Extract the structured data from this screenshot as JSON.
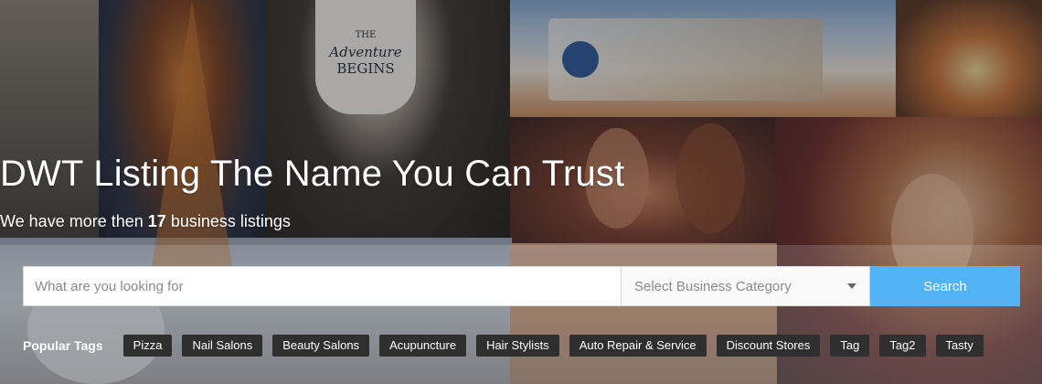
{
  "hero": {
    "title": "DWT Listing The Name You Can Trust",
    "subtitle_prefix": "We have more then",
    "listing_count": "17",
    "subtitle_suffix": "business listings",
    "mug_text_1": "THE",
    "mug_text_2": "Adventure",
    "mug_text_3": "BEGINS"
  },
  "search": {
    "placeholder": "What are you looking for",
    "category_placeholder": "Select Business Category",
    "button_label": "Search"
  },
  "popular_tags": {
    "label": "Popular Tags",
    "tags": [
      "Pizza",
      "Nail Salons",
      "Beauty Salons",
      "Acupuncture",
      "Hair Stylists",
      "Auto Repair & Service",
      "Discount Stores",
      "Tag",
      "Tag2",
      "Tasty"
    ]
  },
  "colors": {
    "search_button": "#52b4f6",
    "tag_background": "#2f2f2f"
  }
}
